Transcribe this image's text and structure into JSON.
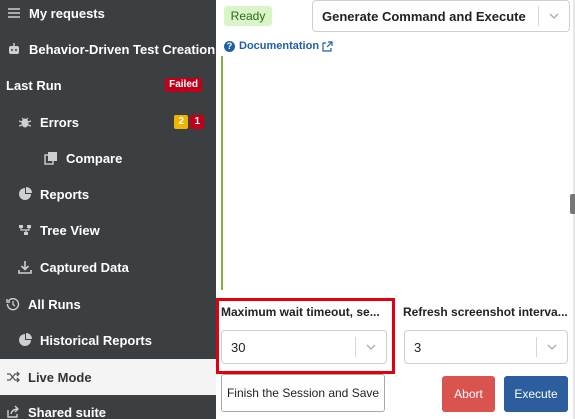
{
  "sidebar": {
    "items": [
      {
        "label": "My requests",
        "icon": "list-icon"
      },
      {
        "label": "Behavior-Driven Test Creation",
        "icon": "robot-icon"
      },
      {
        "label": "Last Run",
        "badge": "Failed"
      },
      {
        "label": "Errors",
        "icon": "bug-icon",
        "warn_count": "2",
        "error_count": "1"
      },
      {
        "label": "Compare",
        "icon": "copy-icon"
      },
      {
        "label": "Reports",
        "icon": "pie-chart-icon"
      },
      {
        "label": "Tree View",
        "icon": "tree-icon"
      },
      {
        "label": "Captured Data",
        "icon": "download-icon"
      },
      {
        "label": "All Runs",
        "icon": "history-icon"
      },
      {
        "label": "Historical Reports",
        "icon": "pie-chart-icon"
      },
      {
        "label": "Live Mode",
        "icon": "shuffle-icon",
        "active": true
      },
      {
        "label": "Shared suite",
        "icon": "share-icon"
      }
    ]
  },
  "status": {
    "label": "Ready",
    "color": "#d9f5c8"
  },
  "command_select": {
    "value": "Generate Command and Execute"
  },
  "documentation": {
    "label": "Documentation"
  },
  "fields": {
    "max_wait": {
      "label": "Maximum wait timeout, se...",
      "value": "30"
    },
    "refresh": {
      "label": "Refresh screenshot interva...",
      "value": "3"
    }
  },
  "buttons": {
    "finish": "Finish the Session and Save",
    "abort": "Abort",
    "execute": "Execute"
  },
  "colors": {
    "sidebar_bg": "#3c3f41",
    "failed_badge": "#c0001a",
    "warn_badge": "#f0b400",
    "abort": "#d9534f",
    "execute": "#2c5e9e",
    "highlight": "#e0000e"
  }
}
